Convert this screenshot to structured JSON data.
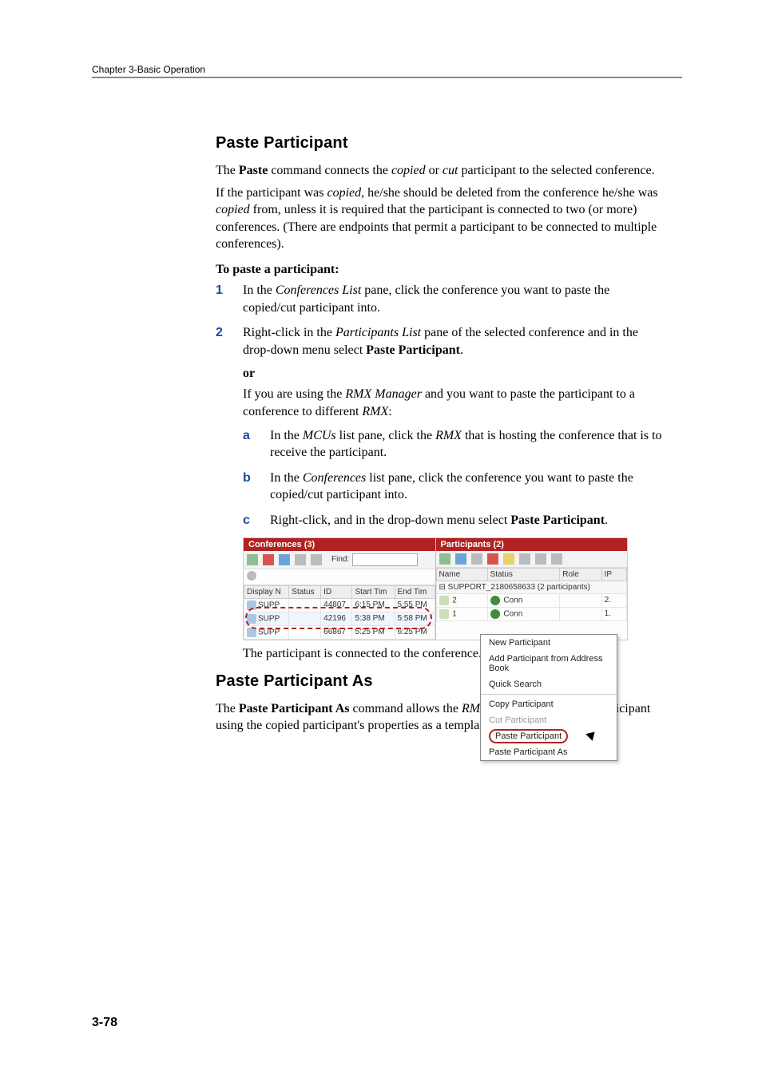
{
  "header": {
    "chapter": "Chapter 3-Basic Operation"
  },
  "section1": {
    "title": "Paste Participant",
    "para1_a": "The ",
    "para1_b": "Paste",
    "para1_c": " command connects the ",
    "para1_d": "copied",
    "para1_e": " or ",
    "para1_f": "cut",
    "para1_g": " participant to the selected conference.",
    "para2_a": "If the participant was ",
    "para2_b": "copied",
    "para2_c": ", he/she should be deleted from the conference he/she was ",
    "para2_d": "copied",
    "para2_e": " from, unless it is required that the participant is connected to two (or more) conferences. (There are endpoints that permit a participant to be connected to multiple conferences).",
    "subhead": "To paste a participant:",
    "step1_a": "In the ",
    "step1_b": "Conferences List",
    "step1_c": " pane, click the conference you want to paste the copied/cut participant into.",
    "step2_a": "Right-click in the ",
    "step2_b": "Participants List",
    "step2_c": " pane of the selected conference and in the drop-down menu select ",
    "step2_d": "Paste Participant",
    "step2_e": ".",
    "or": "or",
    "afteror_a": "If you are using the ",
    "afteror_b": "RMX Manager",
    "afteror_c": " and you want to paste the participant to a conference to different ",
    "afteror_d": "RMX",
    "afteror_e": ":",
    "sa_a": "In the ",
    "sa_b": "MCUs",
    "sa_c": " list pane, click the ",
    "sa_d": "RMX",
    "sa_e": " that is hosting the conference that is to receive the participant.",
    "sb_a": "In the ",
    "sb_b": "Conferences",
    "sb_c": " list pane, click the conference you want to paste the copied/cut participant into.",
    "sc_a": "Right-click, and in the drop-down menu select ",
    "sc_b": "Paste Participant",
    "sc_c": ".",
    "caption": "The participant is connected to the conference."
  },
  "section2": {
    "title": "Paste Participant As",
    "para_a": "The ",
    "para_b": "Paste Participant As",
    "para_c": " command allows the ",
    "para_d": "RMX",
    "para_e": " user to create a new participant using the copied participant's properties as a template. It"
  },
  "screenshot": {
    "left": {
      "title": "Conferences (3)",
      "find_label": "Find:",
      "columns": [
        "Display N",
        "Status",
        "ID",
        "Start Tim",
        "End Tim"
      ],
      "rows": [
        {
          "name": "SUPP",
          "id": "44807",
          "start": "6:15 PM",
          "end": "5:55 PM"
        },
        {
          "name": "SUPP",
          "id": "42196",
          "start": "5:38 PM",
          "end": "5:58 PM",
          "highlight": true
        },
        {
          "name": "SUPP",
          "id": "66867",
          "start": "5:25 PM",
          "end": "6:25 PM"
        }
      ]
    },
    "right": {
      "title": "Participants (2)",
      "columns": [
        "Name",
        "Status",
        "Role",
        "IP"
      ],
      "group": "SUPPORT_2180658633 (2 participants)",
      "rows": [
        {
          "name": "2",
          "status": "Conn",
          "ip": "2."
        },
        {
          "name": "1",
          "status": "Conn",
          "ip": "1."
        }
      ],
      "menu": {
        "items": [
          "New Participant",
          "Add Participant from Address Book",
          "Quick Search",
          "Copy Participant",
          "Cut Participant",
          "Paste Participant",
          "Paste Participant As"
        ]
      }
    }
  },
  "page_number": "3-78"
}
